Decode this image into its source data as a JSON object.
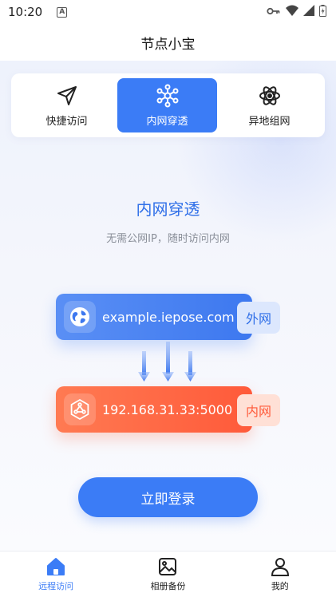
{
  "status_bar": {
    "time": "10:20",
    "notification_badge": "A",
    "icons": [
      "key-icon",
      "wifi-icon",
      "signal-icon",
      "battery-icon"
    ]
  },
  "header": {
    "title": "节点小宝"
  },
  "tabs": [
    {
      "label": "快捷访问",
      "icon": "paper-plane-icon",
      "active": false
    },
    {
      "label": "内网穿透",
      "icon": "network-nodes-icon",
      "active": true
    },
    {
      "label": "异地组网",
      "icon": "atom-icon",
      "active": false
    }
  ],
  "hero": {
    "title": "内网穿透",
    "subtitle": "无需公网IP，随时访问内网"
  },
  "external": {
    "address": "example.iepose.com",
    "tag": "外网",
    "icon": "globe-icon"
  },
  "internal": {
    "address": "192.168.31.33:5000",
    "tag": "内网",
    "icon": "network-hexagon-icon"
  },
  "login_button": "立即登录",
  "bottom_nav": [
    {
      "label": "远程访问",
      "icon": "home-icon",
      "active": true
    },
    {
      "label": "相册备份",
      "icon": "photo-icon",
      "active": false
    },
    {
      "label": "我的",
      "icon": "user-icon",
      "active": false
    }
  ],
  "colors": {
    "accent": "#3b7cf6",
    "orange": "#ff5a3a",
    "subtitle": "#8a8f99"
  }
}
